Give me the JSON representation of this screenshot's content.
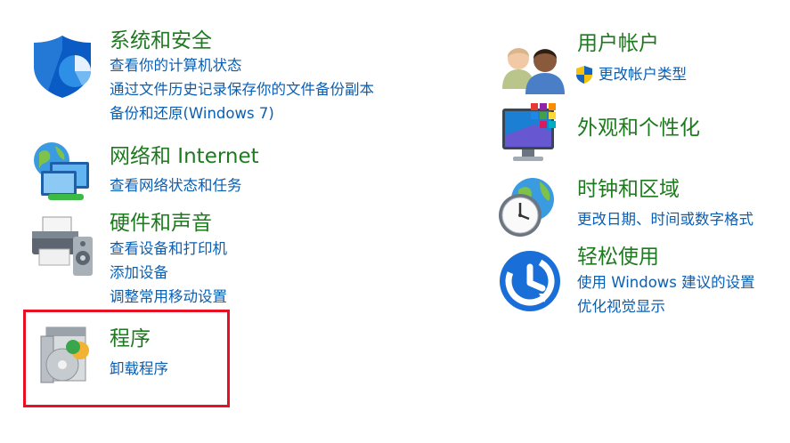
{
  "categories": {
    "system": {
      "title": "系统和安全",
      "links": [
        "查看你的计算机状态",
        "通过文件历史记录保存你的文件备份副本",
        "备份和还原(Windows 7)"
      ]
    },
    "network": {
      "title": "网络和 Internet",
      "links": [
        "查看网络状态和任务"
      ]
    },
    "hardware": {
      "title": "硬件和声音",
      "links": [
        "查看设备和打印机",
        "添加设备",
        "调整常用移动设置"
      ]
    },
    "programs": {
      "title": "程序",
      "links": [
        "卸载程序"
      ]
    },
    "user": {
      "title": "用户帐户",
      "links": [
        "更改帐户类型"
      ]
    },
    "appearance": {
      "title": "外观和个性化",
      "links": []
    },
    "clock": {
      "title": "时钟和区域",
      "links": [
        "更改日期、时间或数字格式"
      ]
    },
    "ease": {
      "title": "轻松使用",
      "links": [
        "使用 Windows 建议的设置",
        "优化视觉显示"
      ]
    }
  },
  "icons": {
    "system": "security-shield-icon",
    "network": "network-globe-icon",
    "hardware": "printer-speaker-icon",
    "programs": "programs-disc-icon",
    "user": "user-accounts-icon",
    "appearance": "appearance-monitor-icon",
    "clock": "clock-globe-icon",
    "ease": "ease-of-access-icon",
    "uac": "uac-shield-icon"
  },
  "colors": {
    "title": "#1e7a1e",
    "link": "#0b5fb3",
    "highlight": "#e81123"
  }
}
